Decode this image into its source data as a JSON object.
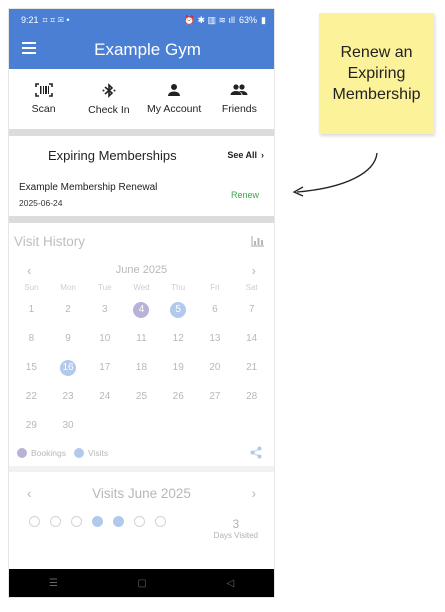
{
  "status_bar": {
    "time": "9:21",
    "battery": "63%"
  },
  "app_bar": {
    "title": "Example Gym"
  },
  "quick_actions": [
    {
      "label": "Scan",
      "icon": "barcode-scan-icon"
    },
    {
      "label": "Check In",
      "icon": "bluetooth-icon"
    },
    {
      "label": "My Account",
      "icon": "person-icon"
    },
    {
      "label": "Friends",
      "icon": "people-icon"
    }
  ],
  "expiring": {
    "heading": "Expiring Memberships",
    "see_all": "See All",
    "item": {
      "name": "Example Membership Renewal",
      "date": "2025-06-24",
      "action": "Renew"
    }
  },
  "visit_history": {
    "heading": "Visit History",
    "month": "June 2025",
    "weekdays": [
      "Sun",
      "Mon",
      "Tue",
      "Wed",
      "Thu",
      "Fri",
      "Sat"
    ],
    "days": [
      "1",
      "2",
      "3",
      "4",
      "5",
      "6",
      "7",
      "8",
      "9",
      "10",
      "11",
      "12",
      "13",
      "14",
      "15",
      "16",
      "17",
      "18",
      "19",
      "20",
      "21",
      "22",
      "23",
      "24",
      "25",
      "26",
      "27",
      "28",
      "29",
      "30"
    ],
    "booking_days": [
      "4"
    ],
    "visit_days": [
      "5",
      "16"
    ],
    "legend": {
      "bookings": "Bookings",
      "visits": "Visits"
    },
    "colors": {
      "booking": "#5b4a9e",
      "visit": "#4a7fd4"
    }
  },
  "visits_month": {
    "heading": "Visits June 2025",
    "count": "3",
    "count_label": "Days Visited"
  },
  "annotation": {
    "note": "Renew an Expiring Membership"
  },
  "colors": {
    "brand": "#4a7fd4",
    "renew": "#3aa64a",
    "note": "#fcf29a"
  }
}
